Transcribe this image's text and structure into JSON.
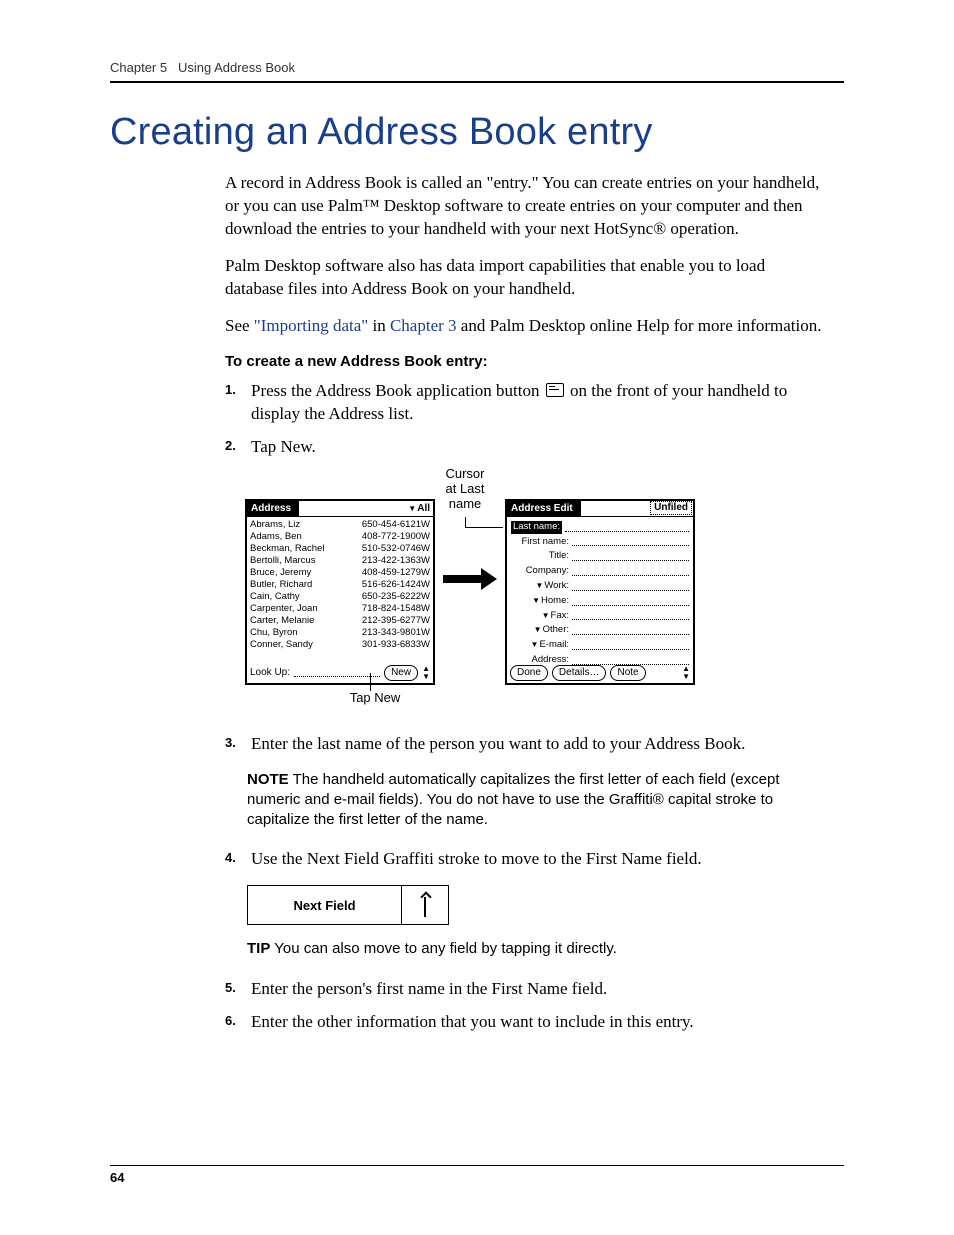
{
  "header": {
    "chapter_label": "Chapter 5",
    "chapter_title": "Using Address Book"
  },
  "title": "Creating an Address Book entry",
  "intro": {
    "p1a": "A record in Address Book is called an \"entry.\" You can create entries on your handheld, or you can use Palm",
    "p1b": " Desktop software to create entries on your computer and then download the entries to your handheld with your next HotSync",
    "p1c": " operation.",
    "p2": "Palm Desktop software also has data import capabilities that enable you to load database files into Address Book on your handheld.",
    "p3_a": "See ",
    "p3_link1": "\"Importing data\"",
    "p3_b": " in ",
    "p3_link2": "Chapter 3",
    "p3_c": " and Palm Desktop online Help for more information."
  },
  "subhead": "To create a new Address Book entry:",
  "steps": {
    "s1a": "Press the Address Book application button ",
    "s1b": " on the front of your handheld to display the Address list.",
    "s2": "Tap New.",
    "s3": "Enter the last name of the person you want to add to your Address Book.",
    "s4": "Use the Next Field Graffiti stroke to move to the First Name field.",
    "s5": "Enter the person's first name in the First Name field.",
    "s6": "Enter the other information that you want to include in this entry."
  },
  "figure": {
    "callout_cursor": "Cursor\nat Last\nname",
    "callout_tap_new": "Tap New",
    "left_screen": {
      "title": "Address",
      "category": "All",
      "lookup_label": "Look Up:",
      "new_button": "New",
      "list": [
        {
          "name": "Abrams, Liz",
          "phone": "650-454-6121W"
        },
        {
          "name": "Adams, Ben",
          "phone": "408-772-1900W"
        },
        {
          "name": "Beckman, Rachel",
          "phone": "510-532-0746W"
        },
        {
          "name": "Bertolli, Marcus",
          "phone": "213-422-1363W"
        },
        {
          "name": "Bruce, Jeremy",
          "phone": "408-459-1279W"
        },
        {
          "name": "Butler, Richard",
          "phone": "516-626-1424W"
        },
        {
          "name": "Cain, Cathy",
          "phone": "650-235-6222W"
        },
        {
          "name": "Carpenter, Joan",
          "phone": "718-824-1548W"
        },
        {
          "name": "Carter, Melanie",
          "phone": "212-395-6277W"
        },
        {
          "name": "Chu, Byron",
          "phone": "213-343-9801W"
        },
        {
          "name": "Conner, Sandy",
          "phone": "301-933-6833W"
        }
      ]
    },
    "right_screen": {
      "title": "Address Edit",
      "category": "Unfiled",
      "fields": {
        "last_name": "Last name:",
        "first_name": "First name:",
        "title": "Title:",
        "company": "Company:",
        "work": "Work:",
        "home": "Home:",
        "fax": "Fax:",
        "other": "Other:",
        "email": "E-mail:",
        "address": "Address:"
      },
      "buttons": {
        "done": "Done",
        "details": "Details…",
        "note": "Note"
      }
    }
  },
  "note": {
    "kw": "NOTE",
    "text": "  The handheld automatically capitalizes the first letter of each field (except numeric and e-mail fields). You do not have to use the Graffiti",
    "text2": " capital stroke to capitalize the first letter of the name."
  },
  "next_field_label": "Next Field",
  "tip": {
    "kw": "TIP",
    "text": "  You can also move to any field by tapping it directly."
  },
  "page_number": "64"
}
